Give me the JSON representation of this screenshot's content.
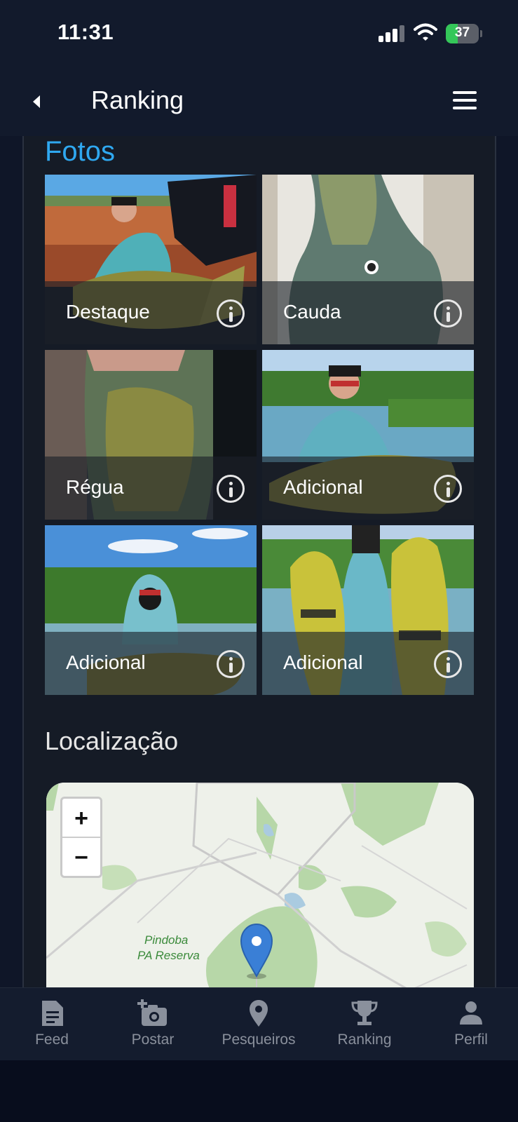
{
  "status_bar": {
    "time": "11:31",
    "battery": "37"
  },
  "header": {
    "title": "Ranking"
  },
  "photos": {
    "title": "Fotos",
    "items": [
      {
        "label": "Destaque"
      },
      {
        "label": "Cauda"
      },
      {
        "label": "Régua"
      },
      {
        "label": "Adicional"
      },
      {
        "label": "Adicional"
      },
      {
        "label": "Adicional"
      }
    ]
  },
  "location": {
    "title": "Localização",
    "map": {
      "zoom_in": "+",
      "zoom_out": "−",
      "place_label_1": "Pindoba",
      "place_label_2": "PA Reserva"
    }
  },
  "nav": {
    "items": [
      {
        "label": "Feed",
        "icon": "document-icon"
      },
      {
        "label": "Postar",
        "icon": "add-photo-icon"
      },
      {
        "label": "Pesqueiros",
        "icon": "location-pin-icon"
      },
      {
        "label": "Ranking",
        "icon": "trophy-icon"
      },
      {
        "label": "Perfil",
        "icon": "person-icon"
      }
    ]
  },
  "colors": {
    "accent": "#2fa8f0",
    "background": "#111a2c",
    "card": "#151b26",
    "nav_inactive": "#8a909c",
    "battery": "#34c759",
    "map_pin": "#3a7fd6"
  }
}
